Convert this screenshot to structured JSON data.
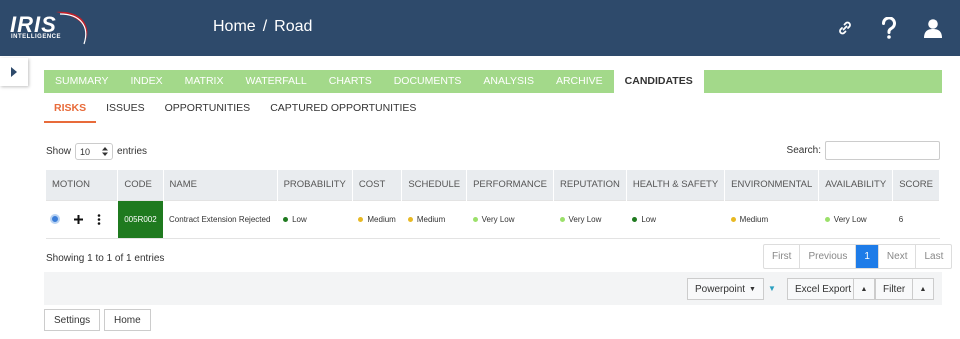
{
  "header": {
    "logo_main": "IRIS",
    "logo_sub": "INTELLIGENCE",
    "breadcrumb": [
      "Home",
      "Road"
    ],
    "breadcrumb_sep": "/",
    "icons": [
      "link-icon",
      "help-icon",
      "user-icon"
    ]
  },
  "tabs": [
    "SUMMARY",
    "INDEX",
    "MATRIX",
    "WATERFALL",
    "CHARTS",
    "DOCUMENTS",
    "ANALYSIS",
    "ARCHIVE",
    "CANDIDATES"
  ],
  "active_tab": "CANDIDATES",
  "subtabs": [
    "RISKS",
    "ISSUES",
    "OPPORTUNITIES",
    "CAPTURED OPPORTUNITIES"
  ],
  "active_subtab": "RISKS",
  "length": {
    "show_label": "Show",
    "value": "10",
    "entries_label": "entries"
  },
  "search": {
    "label": "Search:",
    "value": ""
  },
  "table": {
    "columns": [
      "MOTION",
      "CODE",
      "NAME",
      "PROBABILITY",
      "COST",
      "SCHEDULE",
      "PERFORMANCE",
      "REPUTATION",
      "HEALTH & SAFETY",
      "ENVIRONMENTAL",
      "AVAILABILITY",
      "SCORE"
    ],
    "rows": [
      {
        "code": "005R002",
        "name": "Contract Extension Rejected",
        "probability": "Low",
        "cost": "Medium",
        "schedule": "Medium",
        "performance": "Very Low",
        "reputation": "Very Low",
        "health_safety": "Low",
        "environmental": "Medium",
        "availability": "Very Low",
        "score": "6"
      }
    ]
  },
  "level_colors": {
    "Low": "#1f7a1f",
    "Medium": "#e8b923",
    "Very Low": "#9be06a"
  },
  "info": "Showing 1 to 1 of 1 entries",
  "pager": {
    "first": "First",
    "previous": "Previous",
    "current": "1",
    "next": "Next",
    "last": "Last"
  },
  "toolbar": {
    "powerpoint": "Powerpoint",
    "excel": "Excel Export",
    "filter": "Filter"
  },
  "bottom": {
    "settings": "Settings",
    "home": "Home"
  }
}
